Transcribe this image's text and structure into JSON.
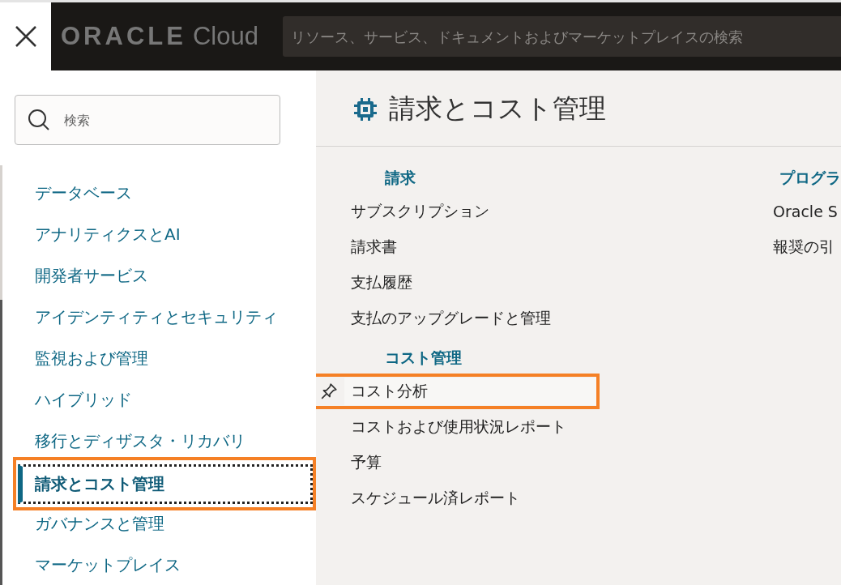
{
  "header": {
    "logo_brand": "ORACLE",
    "logo_product": "Cloud",
    "search": {
      "placeholder": "リソース、サービス、ドキュメントおよびマーケットプレイスの検索"
    }
  },
  "sidebar": {
    "search": {
      "placeholder": "検索"
    },
    "items": [
      {
        "label": "データベース",
        "selected": false,
        "highlighted": false
      },
      {
        "label": "アナリティクスとAI",
        "selected": false,
        "highlighted": false
      },
      {
        "label": "開発者サービス",
        "selected": false,
        "highlighted": false
      },
      {
        "label": "アイデンティティとセキュリティ",
        "selected": false,
        "highlighted": false
      },
      {
        "label": "監視および管理",
        "selected": false,
        "highlighted": false
      },
      {
        "label": "ハイブリッド",
        "selected": false,
        "highlighted": false
      },
      {
        "label": "移行とディザスタ・リカバリ",
        "selected": false,
        "highlighted": false
      },
      {
        "label": "請求とコスト管理",
        "selected": true,
        "highlighted": true
      },
      {
        "label": "ガバナンスと管理",
        "selected": false,
        "highlighted": false
      },
      {
        "label": "マーケットプレイス",
        "selected": false,
        "highlighted": false
      }
    ]
  },
  "panel": {
    "title": "請求とコスト管理",
    "columns": [
      {
        "sections": [
          {
            "heading": "請求",
            "links": [
              {
                "label": "サブスクリプション",
                "pinned": false,
                "highlighted": false
              },
              {
                "label": "請求書",
                "pinned": false,
                "highlighted": false
              },
              {
                "label": "支払履歴",
                "pinned": false,
                "highlighted": false
              },
              {
                "label": "支払のアップグレードと管理",
                "pinned": false,
                "highlighted": false
              }
            ]
          },
          {
            "heading": "コスト管理",
            "links": [
              {
                "label": "コスト分析",
                "pinned": true,
                "highlighted": true
              },
              {
                "label": "コストおよび使用状況レポート",
                "pinned": false,
                "highlighted": false
              },
              {
                "label": "予算",
                "pinned": false,
                "highlighted": false
              },
              {
                "label": "スケジュール済レポート",
                "pinned": false,
                "highlighted": false
              }
            ]
          }
        ]
      },
      {
        "sections": [
          {
            "heading": "プログラ",
            "links": [
              {
                "label": "Oracle S",
                "pinned": false,
                "highlighted": false
              },
              {
                "label": "報奨の引",
                "pinned": false,
                "highlighted": false
              }
            ]
          }
        ]
      }
    ]
  }
}
